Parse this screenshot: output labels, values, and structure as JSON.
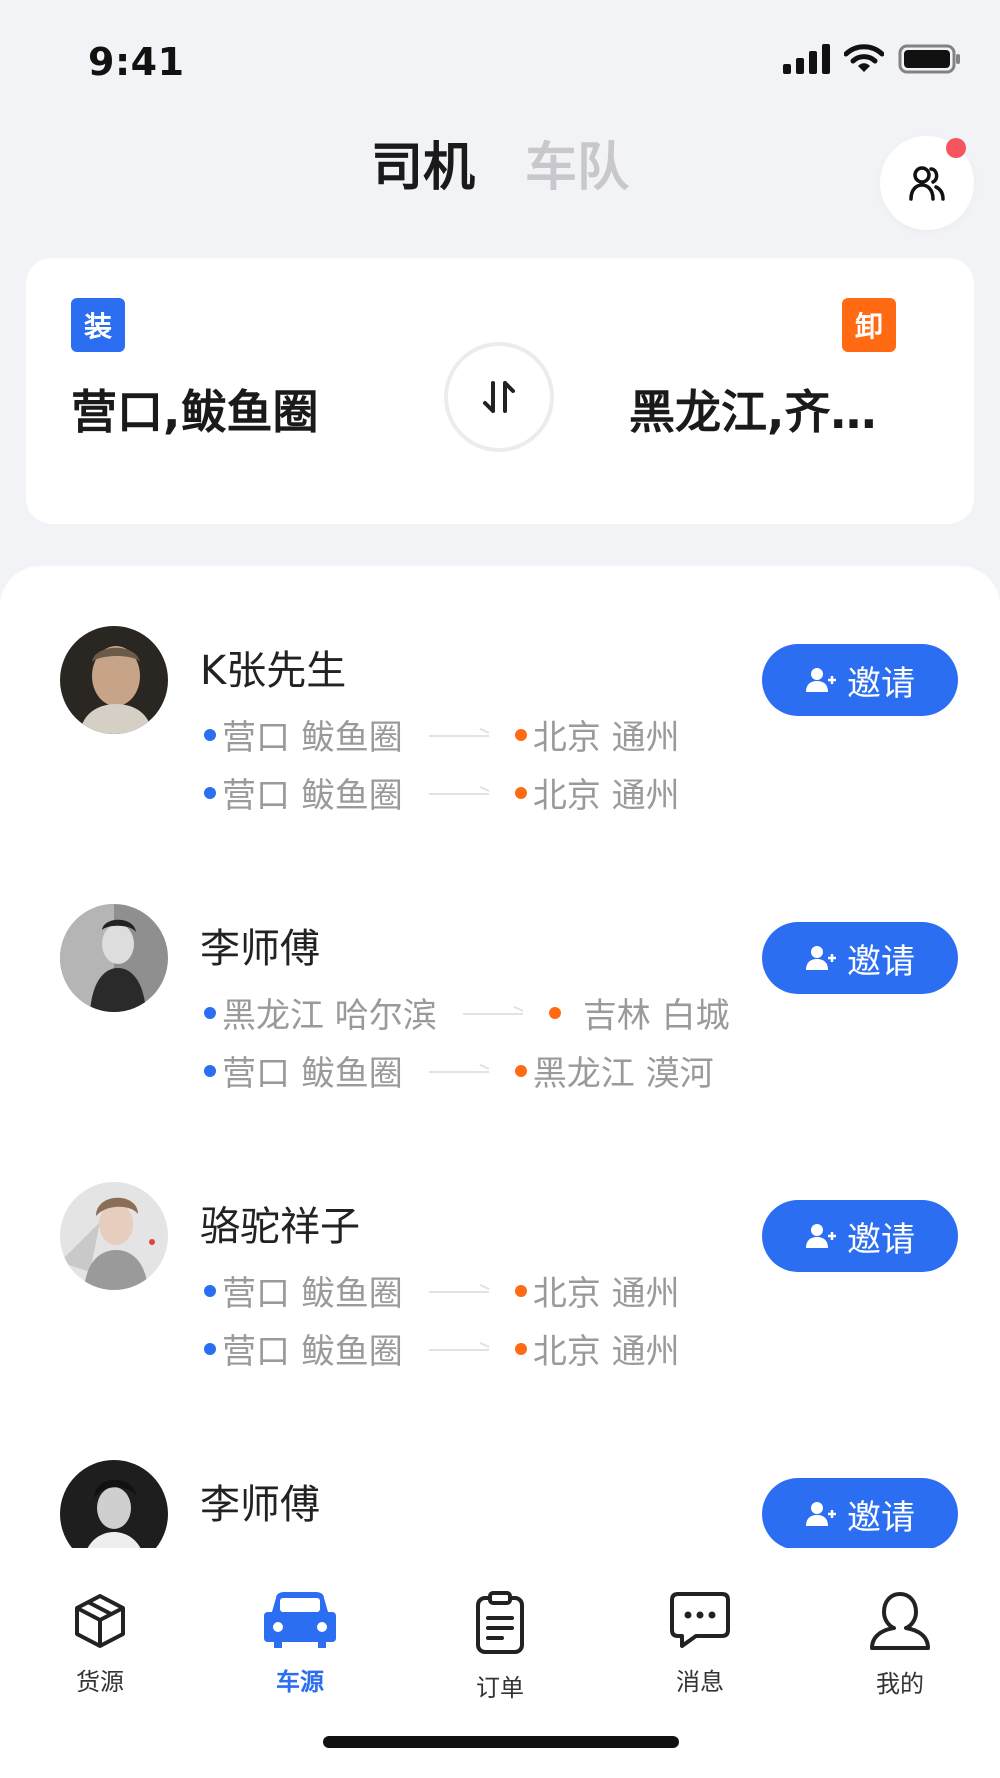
{
  "status_bar": {
    "time": "9:41"
  },
  "header": {
    "tabs": [
      {
        "label": "司机",
        "active": true
      },
      {
        "label": "车队",
        "active": false
      }
    ],
    "team_icon": "team-icon",
    "has_notification": true
  },
  "route_card": {
    "load_tag": "装",
    "unload_tag": "卸",
    "origin": "营口,鲅鱼圈",
    "destination": "黑龙江,齐…",
    "swap_icon": "swap-icon"
  },
  "drivers": [
    {
      "name": "K张先生",
      "routes": [
        {
          "from": "营口 鲅鱼圈",
          "to": "北京 通州"
        },
        {
          "from": "营口 鲅鱼圈",
          "to": "北京 通州"
        }
      ],
      "invite_label": "邀请"
    },
    {
      "name": "李师傅",
      "routes": [
        {
          "from": "黑龙江 哈尔滨",
          "to": "吉林 白城"
        },
        {
          "from": "营口 鲅鱼圈",
          "to": "黑龙江 漠河"
        }
      ],
      "invite_label": "邀请"
    },
    {
      "name": "骆驼祥子",
      "routes": [
        {
          "from": "营口 鲅鱼圈",
          "to": "北京 通州"
        },
        {
          "from": "营口 鲅鱼圈",
          "to": "北京 通州"
        }
      ],
      "invite_label": "邀请"
    },
    {
      "name": "李师傅",
      "routes": [],
      "invite_label": "邀请"
    }
  ],
  "tab_bar": {
    "items": [
      {
        "label": "货源",
        "icon": "box-icon",
        "active": false
      },
      {
        "label": "车源",
        "icon": "car-icon",
        "active": true
      },
      {
        "label": "订单",
        "icon": "clipboard-icon",
        "active": false
      },
      {
        "label": "消息",
        "icon": "message-icon",
        "active": false
      },
      {
        "label": "我的",
        "icon": "user-icon",
        "active": false
      }
    ]
  },
  "colors": {
    "primary": "#2b6ef2",
    "orange": "#ff6a13",
    "background": "#f2f3f7",
    "notification": "#f5555f"
  }
}
